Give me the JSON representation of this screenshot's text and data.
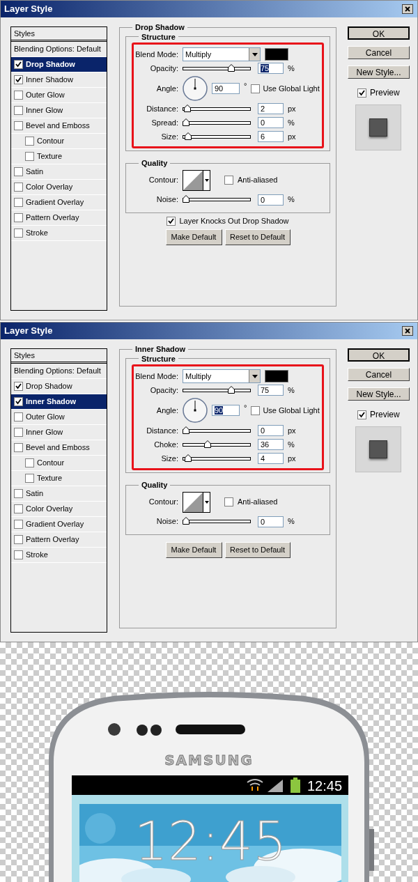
{
  "dialogs": [
    {
      "title": "Layer Style",
      "styles": {
        "header": "Styles",
        "items": [
          {
            "kind": "plain",
            "label": "Blending Options: Default",
            "selected": false
          },
          {
            "kind": "check",
            "label": "Drop Shadow",
            "checked": true,
            "selected": true
          },
          {
            "kind": "check",
            "label": "Inner Shadow",
            "checked": true,
            "selected": false
          },
          {
            "kind": "check",
            "label": "Outer Glow",
            "checked": false,
            "selected": false
          },
          {
            "kind": "check",
            "label": "Inner Glow",
            "checked": false,
            "selected": false
          },
          {
            "kind": "check",
            "label": "Bevel and Emboss",
            "checked": false,
            "selected": false,
            "children": [
              {
                "kind": "check",
                "label": "Contour",
                "checked": false,
                "selected": false
              },
              {
                "kind": "check",
                "label": "Texture",
                "checked": false,
                "selected": false
              }
            ]
          },
          {
            "kind": "check",
            "label": "Satin",
            "checked": false,
            "selected": false
          },
          {
            "kind": "check",
            "label": "Color Overlay",
            "checked": false,
            "selected": false
          },
          {
            "kind": "check",
            "label": "Gradient Overlay",
            "checked": false,
            "selected": false
          },
          {
            "kind": "check",
            "label": "Pattern Overlay",
            "checked": false,
            "selected": false
          },
          {
            "kind": "check",
            "label": "Stroke",
            "checked": false,
            "selected": false
          }
        ]
      },
      "panel": {
        "title": "Drop Shadow",
        "structure": {
          "title": "Structure",
          "rows": [
            {
              "kind": "blend",
              "label": "Blend Mode:",
              "value": "Multiply"
            },
            {
              "kind": "slider",
              "label": "Opacity:",
              "level": 0.75,
              "value": "75",
              "unit": "%",
              "highlighted": true
            },
            {
              "kind": "angle",
              "label": "Angle:",
              "value": "90",
              "unit": "°",
              "highlighted": false,
              "global_light": {
                "label": "Use Global Light",
                "checked": false
              }
            },
            {
              "kind": "slider",
              "label": "Distance:",
              "level": 0.02,
              "value": "2",
              "unit": "px",
              "highlighted": false
            },
            {
              "kind": "slider",
              "label": "Spread:",
              "level": 0,
              "value": "0",
              "unit": "%",
              "highlighted": false
            },
            {
              "kind": "slider",
              "label": "Size:",
              "level": 0.04,
              "value": "6",
              "unit": "px",
              "highlighted": false
            }
          ]
        },
        "quality": {
          "title": "Quality",
          "contour_label": "Contour:",
          "anti_aliased": {
            "label": "Anti-aliased",
            "checked": false
          },
          "noise": {
            "label": "Noise:",
            "level": 0,
            "value": "0",
            "unit": "%"
          }
        },
        "knockout": {
          "label": "Layer Knocks Out Drop Shadow",
          "checked": true
        },
        "buttons": [
          "Make Default",
          "Reset to Default"
        ]
      },
      "actions": [
        {
          "label": "OK",
          "default": true
        },
        {
          "label": "Cancel",
          "default": false
        },
        {
          "label": "New Style...",
          "default": false
        }
      ],
      "preview": {
        "label": "Preview",
        "checked": true
      }
    },
    {
      "title": "Layer Style",
      "styles": {
        "header": "Styles",
        "items": [
          {
            "kind": "plain",
            "label": "Blending Options: Default",
            "selected": false
          },
          {
            "kind": "check",
            "label": "Drop Shadow",
            "checked": true,
            "selected": false
          },
          {
            "kind": "check",
            "label": "Inner Shadow",
            "checked": true,
            "selected": true
          },
          {
            "kind": "check",
            "label": "Outer Glow",
            "checked": false,
            "selected": false
          },
          {
            "kind": "check",
            "label": "Inner Glow",
            "checked": false,
            "selected": false
          },
          {
            "kind": "check",
            "label": "Bevel and Emboss",
            "checked": false,
            "selected": false,
            "children": [
              {
                "kind": "check",
                "label": "Contour",
                "checked": false,
                "selected": false
              },
              {
                "kind": "check",
                "label": "Texture",
                "checked": false,
                "selected": false
              }
            ]
          },
          {
            "kind": "check",
            "label": "Satin",
            "checked": false,
            "selected": false
          },
          {
            "kind": "check",
            "label": "Color Overlay",
            "checked": false,
            "selected": false
          },
          {
            "kind": "check",
            "label": "Gradient Overlay",
            "checked": false,
            "selected": false
          },
          {
            "kind": "check",
            "label": "Pattern Overlay",
            "checked": false,
            "selected": false
          },
          {
            "kind": "check",
            "label": "Stroke",
            "checked": false,
            "selected": false
          }
        ]
      },
      "panel": {
        "title": "Inner Shadow",
        "structure": {
          "title": "Structure",
          "rows": [
            {
              "kind": "blend",
              "label": "Blend Mode:",
              "value": "Multiply"
            },
            {
              "kind": "slider",
              "label": "Opacity:",
              "level": 0.75,
              "value": "75",
              "unit": "%",
              "highlighted": false
            },
            {
              "kind": "angle",
              "label": "Angle:",
              "value": "90",
              "unit": "°",
              "highlighted": true,
              "global_light": {
                "label": "Use Global Light",
                "checked": false
              }
            },
            {
              "kind": "slider",
              "label": "Distance:",
              "level": 0,
              "value": "0",
              "unit": "px",
              "highlighted": false
            },
            {
              "kind": "slider",
              "label": "Choke:",
              "level": 0.36,
              "value": "36",
              "unit": "%",
              "highlighted": false
            },
            {
              "kind": "slider",
              "label": "Size:",
              "level": 0.03,
              "value": "4",
              "unit": "px",
              "highlighted": false
            }
          ]
        },
        "quality": {
          "title": "Quality",
          "contour_label": "Contour:",
          "anti_aliased": {
            "label": "Anti-aliased",
            "checked": false
          },
          "noise": {
            "label": "Noise:",
            "level": 0,
            "value": "0",
            "unit": "%"
          }
        },
        "buttons": [
          "Make Default",
          "Reset to Default"
        ]
      },
      "actions": [
        {
          "label": "OK",
          "default": true
        },
        {
          "label": "Cancel",
          "default": false
        },
        {
          "label": "New Style...",
          "default": false
        }
      ],
      "preview": {
        "label": "Preview",
        "checked": true
      }
    }
  ],
  "phone": {
    "brand": "SAMSUNG",
    "status_time": "12:45",
    "clock": "12:45"
  }
}
